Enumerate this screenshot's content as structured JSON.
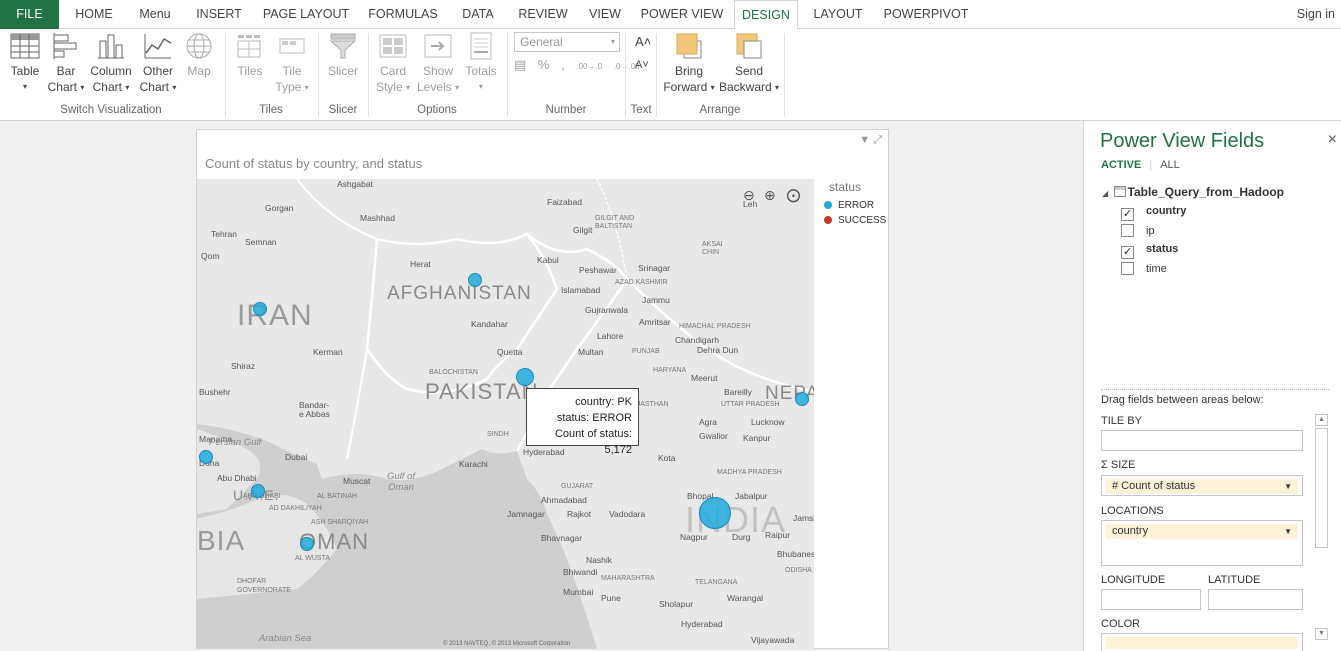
{
  "ribbon_tabs": [
    "FILE",
    "HOME",
    "Menu",
    "INSERT",
    "PAGE LAYOUT",
    "FORMULAS",
    "DATA",
    "REVIEW",
    "VIEW",
    "POWER VIEW",
    "DESIGN",
    "LAYOUT",
    "POWERPIVOT"
  ],
  "active_tab": "DESIGN",
  "sign_in": "Sign in",
  "ribbon": {
    "table": "Table",
    "bar_chart": [
      "Bar",
      "Chart"
    ],
    "column_chart": [
      "Column",
      "Chart"
    ],
    "other_chart": [
      "Other",
      "Chart"
    ],
    "map": "Map",
    "tiles": "Tiles",
    "tile_type": [
      "Tile",
      "Type"
    ],
    "slicer": "Slicer",
    "card_style": [
      "Card",
      "Style"
    ],
    "show_levels": [
      "Show",
      "Levels"
    ],
    "totals": "Totals",
    "number_format": "General",
    "number_icons": [
      "%",
      ",",
      ".00→.0",
      ".0→.00"
    ],
    "text_sizes": [
      "A˄",
      "A˅"
    ],
    "bring_forward": [
      "Bring",
      "Forward"
    ],
    "send_backward": [
      "Send",
      "Backward"
    ],
    "groups": [
      "Switch Visualization",
      "Tiles",
      "Slicer",
      "Options",
      "Number",
      "Text",
      "Arrange"
    ]
  },
  "visualization": {
    "title": "Count of status by country, and status",
    "legend_title": "status",
    "legend": [
      {
        "name": "ERROR",
        "color": "#29a7d6"
      },
      {
        "name": "SUCCESS",
        "color": "#c0392b"
      }
    ],
    "copyright": "© 2013 NAVTEQ, © 2013 Microsoft Corporation",
    "tooltip": {
      "line1": "country: PK",
      "line2": "status: ERROR",
      "line3": "Count of status: 5,172"
    }
  },
  "map_labels": {
    "countries": [
      "IRAN",
      "AFGHANISTAN",
      "PAKISTAN",
      "OMAN",
      "U.A.E.",
      "NEPAL",
      "INDIA",
      "BIA"
    ],
    "cities": [
      "Ashgabat",
      "Gorgan",
      "Mashhad",
      "Tehran",
      "Semnan",
      "Qom",
      "Herat",
      "Kabul",
      "Peshawar",
      "Srinagar",
      "Islamabad",
      "Gujranwala",
      "Jammu",
      "Kandahar",
      "Lahore",
      "Amritsar",
      "Chandigarh",
      "Quetta",
      "Multan",
      "Dehra Dun",
      "Kerman",
      "Shiraz",
      "Meerut",
      "Bareilly",
      "Bushehr",
      "Bandar-e Abbas",
      "Agra",
      "Lucknow",
      "Gwalior",
      "Kanpur",
      "Manama",
      "Doha",
      "Hyderabad",
      "Karachi",
      "Kota",
      "Dubai",
      "Abu Dhabi",
      "Muscat",
      "Ahmadabad",
      "Jamnagar",
      "Rajkot",
      "Vadodara",
      "Bhopal",
      "Jabalpur",
      "Bhavnagar",
      "Nagpur",
      "Durg",
      "Raipur",
      "Nashik",
      "Bhiwandi",
      "Mumbai",
      "Pune",
      "Sholapur",
      "Warangal",
      "Hyderabad",
      "Vijayawada",
      "Jamshedpur",
      "Bhubaneswar",
      "Faizabad",
      "Gilgit",
      "Leh"
    ],
    "regions": [
      "AZAD KASHMIR",
      "GILGIT AND BALTISTAN",
      "AKSAI CHIN",
      "PUNJAB",
      "GUJARAT",
      "MADHYA PRADESH",
      "MAHARASHTRA",
      "TELANGANA",
      "ODISHA",
      "DHOFAR GOVERNORATE",
      "AL WUSTA",
      "ASH SHARQIYAH",
      "AD DAKHILIYAH",
      "AL BATINAH",
      "ABU DHABI",
      "HARYANA",
      "HIMACHAL PRADESH",
      "UTTAR PRADESH",
      "RAJASTHAN",
      "SINDH",
      "BALOCHISTAN"
    ],
    "seas": [
      "Persian Gulf",
      "Gulf of Oman",
      "Arabian Sea"
    ]
  },
  "fields_panel": {
    "title": "Power View Fields",
    "tab_active": "ACTIVE",
    "tab_all": "ALL",
    "table_name": "Table_Query_from_Hadoop",
    "fields": [
      {
        "name": "country",
        "checked": true
      },
      {
        "name": "ip",
        "checked": false
      },
      {
        "name": "status",
        "checked": true
      },
      {
        "name": "time",
        "checked": false
      }
    ],
    "drag_hint": "Drag fields between areas below:",
    "tile_by": "TILE BY",
    "size": "Σ SIZE",
    "size_value": "# Count of status",
    "locations": "LOCATIONS",
    "locations_value": "country",
    "longitude": "LONGITUDE",
    "latitude": "LATITUDE",
    "color": "COLOR",
    "close": "×"
  }
}
